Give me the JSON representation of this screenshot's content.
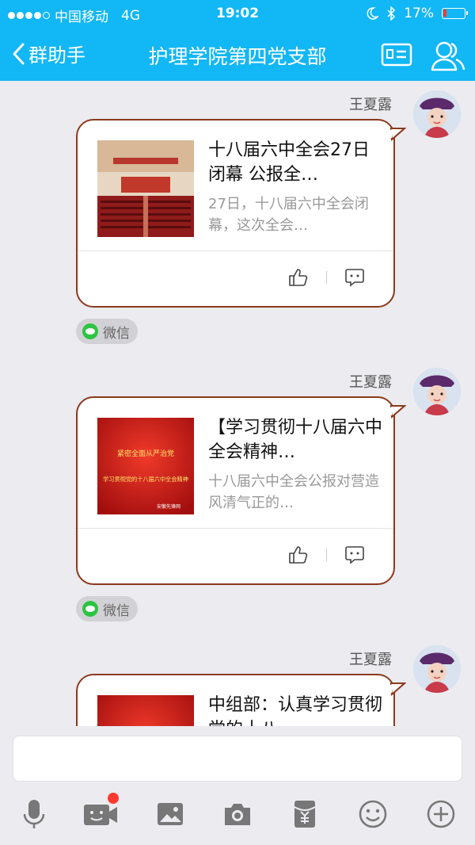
{
  "status_bar": {
    "carrier": "中国移动",
    "network": "4G",
    "time": "19:02",
    "battery": "17%",
    "battery_level": 0.17
  },
  "nav": {
    "back_label": "群助手",
    "title": "护理学院第四党支部",
    "card_icon": "profile-card-icon",
    "members_icon": "group-members-icon"
  },
  "colors": {
    "nav_bar": "#12b7f5",
    "bubble_border": "#8a3a1c",
    "wechat_green": "#2bc542",
    "unread_red": "#ff3b30"
  },
  "messages": [
    {
      "sender": "王夏露",
      "title": "十八届六中全会27日闭幕 公报全…",
      "desc": "27日，十八届六中全会闭幕，这次全会…",
      "source": "微信",
      "thumb": "hall-photo"
    },
    {
      "sender": "王夏露",
      "title": "【学习贯彻十八届六中全会精神…",
      "desc": "十八届六中全会公报对营造风清气正的…",
      "source": "微信",
      "thumb": "red-poster",
      "thumb_line1": "紧密全面从严治党",
      "thumb_line2": "学习贯彻党的十八届六中全会精神",
      "thumb_credit": "安徽先锋网"
    },
    {
      "sender": "王夏露",
      "title": "中组部：认真学习贯彻党的十八…",
      "thumb": "red-poster"
    }
  ],
  "toolbar": [
    {
      "icon": "microphone-icon"
    },
    {
      "icon": "video-call-icon",
      "has_badge": true
    },
    {
      "icon": "image-icon"
    },
    {
      "icon": "camera-icon"
    },
    {
      "icon": "red-packet-icon"
    },
    {
      "icon": "emoji-icon"
    },
    {
      "icon": "plus-icon"
    }
  ]
}
